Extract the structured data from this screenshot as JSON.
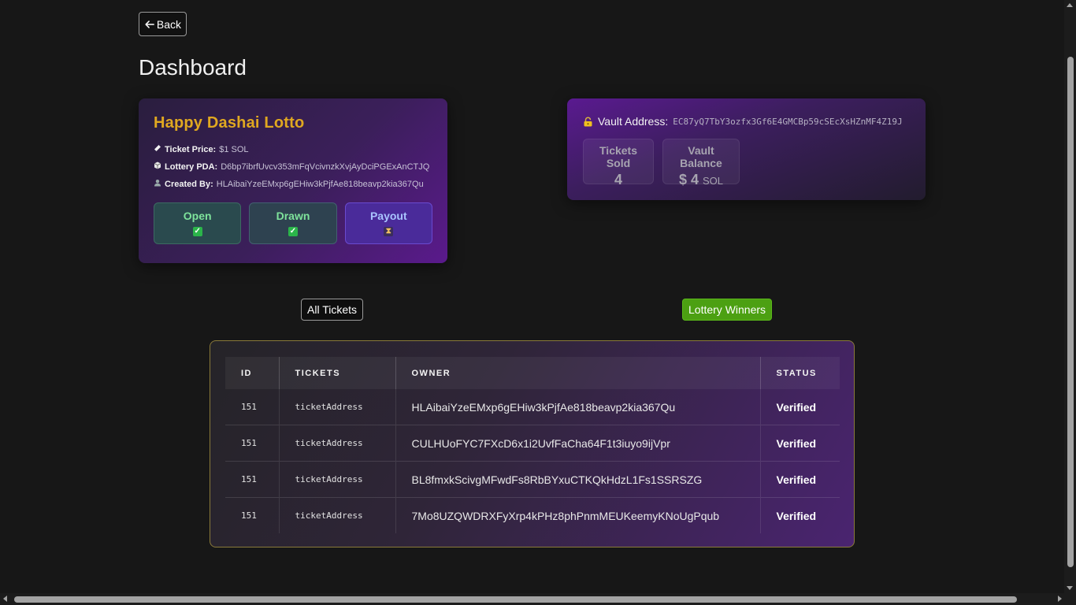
{
  "header": {
    "back_label": "Back",
    "title": "Dashboard"
  },
  "lottery": {
    "name": "Happy Dashai Lotto",
    "ticket_price_label": "Ticket Price:",
    "ticket_price_value": "$1 SOL",
    "pda_label": "Lottery PDA:",
    "pda_value": "D6bp7ibrfUvcv353mFqVcivnzkXvjAyDciPGExAnCTJQ",
    "creator_label": "Created By:",
    "creator_value": "HLAibaiYzeEMxp6gEHiw3kPjfAe818beavp2kia367Qu",
    "statuses": [
      {
        "label": "Open",
        "state": "done"
      },
      {
        "label": "Drawn",
        "state": "done"
      },
      {
        "label": "Payout",
        "state": "pending"
      }
    ],
    "icons": {
      "ticket": "ticket-icon",
      "pda": "cube-icon",
      "creator": "user-icon",
      "done": "check-icon",
      "pending": "hourglass-icon"
    }
  },
  "vault": {
    "address_label": "Vault Address:",
    "address_value": "EC87yQ7TbY3ozfx3Gf6E4GMCBp59cSEcXsHZnMF4Z19J",
    "tickets_sold_label": "Tickets Sold",
    "tickets_sold_value": "4",
    "balance_label": "Vault Balance",
    "balance_value": "$ 4",
    "balance_unit": "SOL"
  },
  "tabs": {
    "all_tickets": "All Tickets",
    "lottery_winners": "Lottery Winners"
  },
  "table": {
    "headers": [
      "ID",
      "TICKETS",
      "OWNER",
      "STATUS"
    ],
    "rows": [
      {
        "id": "151",
        "ticket": "ticketAddress",
        "owner": "HLAibaiYzeEMxp6gEHiw3kPjfAe818beavp2kia367Qu",
        "status": "Verified"
      },
      {
        "id": "151",
        "ticket": "ticketAddress",
        "owner": "CULHUoFYC7FXcD6x1i2UvfFaCha64F1t3iuyo9ijVpr",
        "status": "Verified"
      },
      {
        "id": "151",
        "ticket": "ticketAddress",
        "owner": "BL8fmxkScivgMFwdFs8RbBYxuCTKQkHdzL1Fs1SSRSZG",
        "status": "Verified"
      },
      {
        "id": "151",
        "ticket": "ticketAddress",
        "owner": "7Mo8UZQWDRXFyXrp4kPHz8phPnmMEUKeemyKNoUgPqub",
        "status": "Verified"
      }
    ]
  },
  "colors": {
    "accent_gold": "#e0a820",
    "winners_green": "#4ca012",
    "open_green": "#7ee39b",
    "payout_blue": "#a9c4ff"
  }
}
